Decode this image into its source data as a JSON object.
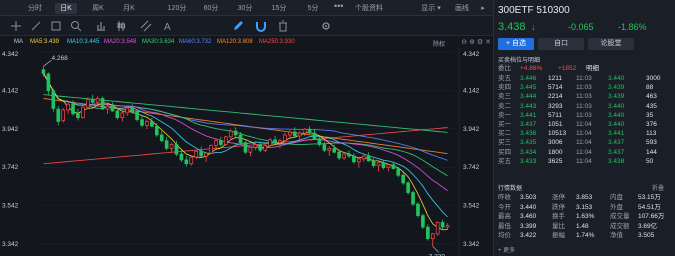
{
  "periods": [
    {
      "label": "分时",
      "active": false
    },
    {
      "label": "日K",
      "active": true
    },
    {
      "label": "周K",
      "active": false
    },
    {
      "label": "月K",
      "active": false
    },
    {
      "label": "120分",
      "active": false
    },
    {
      "label": "60分",
      "active": false
    },
    {
      "label": "30分",
      "active": false
    },
    {
      "label": "15分",
      "active": false
    },
    {
      "label": "5分",
      "active": false
    }
  ],
  "more": "•••",
  "stock_info_tab": "个股资料",
  "display_menu": "显示 ▾",
  "draw_line": "画线",
  "tools": [
    "crosshair-icon",
    "line-tool-icon",
    "rect-tool-icon",
    "zoom-icon",
    "bar-chart-icon",
    "candle-style-icon",
    "parallel-line-icon",
    "text-tool-icon",
    "pencil-icon",
    "magnet-icon",
    "delete-icon",
    "settings-icon"
  ],
  "ma": {
    "label": "MA",
    "ma5": "MA5:3.439",
    "ma10": "MA10:3.445",
    "ma20": "MA20:3.548",
    "ma30": "MA30:3.634",
    "ma60": "MA60:3.732",
    "ma120": "MA120:3.808",
    "ma250": "MA250:3.930",
    "right": "除权",
    "colors": {
      "ma5": "#f5d33a",
      "ma10": "#3fd1f5",
      "ma20": "#e055e0",
      "ma30": "#34d17a",
      "ma60": "#5a86ff",
      "ma120": "#ff8a2a",
      "ma250": "#ff4a4a"
    }
  },
  "chart_data": {
    "type": "candlestick",
    "ylim": [
      3.342,
      4.342
    ],
    "yticks": [
      "4.342",
      "4.142",
      "3.942",
      "3.742",
      "3.542",
      "3.342"
    ],
    "annotations": {
      "high": "4.268",
      "low": "3.330"
    },
    "candles": [
      [
        4.25,
        4.268,
        4.215,
        4.23
      ],
      [
        4.228,
        4.235,
        4.12,
        4.14
      ],
      [
        4.14,
        4.15,
        4.03,
        4.048
      ],
      [
        4.045,
        4.06,
        3.96,
        3.98
      ],
      [
        3.985,
        4.05,
        3.975,
        4.04
      ],
      [
        4.04,
        4.08,
        4.02,
        4.07
      ],
      [
        4.07,
        4.09,
        4.01,
        4.02
      ],
      [
        4.02,
        4.045,
        3.985,
        4.0
      ],
      [
        4.0,
        4.06,
        3.995,
        4.055
      ],
      [
        4.055,
        4.105,
        4.045,
        4.095
      ],
      [
        4.095,
        4.12,
        4.07,
        4.08
      ],
      [
        4.08,
        4.11,
        4.06,
        4.1
      ],
      [
        4.1,
        4.11,
        4.04,
        4.045
      ],
      [
        4.045,
        4.07,
        4.02,
        4.06
      ],
      [
        4.06,
        4.08,
        4.03,
        4.035
      ],
      [
        4.035,
        4.05,
        3.99,
        4.0
      ],
      [
        4.0,
        4.03,
        3.98,
        4.025
      ],
      [
        4.025,
        4.06,
        4.01,
        4.05
      ],
      [
        4.05,
        4.07,
        4.02,
        4.03
      ],
      [
        4.03,
        4.045,
        3.98,
        3.99
      ],
      [
        3.99,
        4.01,
        3.95,
        3.96
      ],
      [
        3.96,
        3.99,
        3.94,
        3.98
      ],
      [
        3.98,
        4.0,
        3.95,
        3.955
      ],
      [
        3.955,
        3.97,
        3.9,
        3.91
      ],
      [
        3.91,
        3.93,
        3.87,
        3.88
      ],
      [
        3.88,
        3.9,
        3.83,
        3.84
      ],
      [
        3.84,
        3.87,
        3.82,
        3.86
      ],
      [
        3.86,
        3.88,
        3.8,
        3.81
      ],
      [
        3.81,
        3.83,
        3.77,
        3.78
      ],
      [
        3.78,
        3.8,
        3.745,
        3.76
      ],
      [
        3.76,
        3.8,
        3.75,
        3.795
      ],
      [
        3.795,
        3.83,
        3.785,
        3.825
      ],
      [
        3.825,
        3.85,
        3.79,
        3.8
      ],
      [
        3.8,
        3.82,
        3.77,
        3.815
      ],
      [
        3.815,
        3.86,
        3.81,
        3.855
      ],
      [
        3.855,
        3.89,
        3.84,
        3.88
      ],
      [
        3.88,
        3.9,
        3.85,
        3.86
      ],
      [
        3.86,
        3.905,
        3.855,
        3.9
      ],
      [
        3.9,
        3.94,
        3.89,
        3.93
      ],
      [
        3.93,
        3.95,
        3.9,
        3.91
      ],
      [
        3.91,
        3.925,
        3.86,
        3.87
      ],
      [
        3.87,
        3.88,
        3.81,
        3.82
      ],
      [
        3.82,
        3.85,
        3.8,
        3.845
      ],
      [
        3.845,
        3.87,
        3.83,
        3.86
      ],
      [
        3.86,
        3.875,
        3.82,
        3.83
      ],
      [
        3.83,
        3.86,
        3.82,
        3.855
      ],
      [
        3.855,
        3.895,
        3.845,
        3.885
      ],
      [
        3.885,
        3.905,
        3.86,
        3.87
      ],
      [
        3.87,
        3.89,
        3.84,
        3.88
      ],
      [
        3.88,
        3.92,
        3.87,
        3.91
      ],
      [
        3.91,
        3.935,
        3.895,
        3.925
      ],
      [
        3.925,
        3.95,
        3.9,
        3.905
      ],
      [
        3.905,
        3.93,
        3.88,
        3.92
      ],
      [
        3.92,
        3.945,
        3.905,
        3.94
      ],
      [
        3.94,
        3.955,
        3.915,
        3.92
      ],
      [
        3.92,
        3.94,
        3.885,
        3.89
      ],
      [
        3.89,
        3.905,
        3.85,
        3.86
      ],
      [
        3.86,
        3.875,
        3.82,
        3.83
      ],
      [
        3.83,
        3.85,
        3.8,
        3.84
      ],
      [
        3.84,
        3.86,
        3.815,
        3.82
      ],
      [
        3.82,
        3.835,
        3.78,
        3.79
      ],
      [
        3.79,
        3.82,
        3.78,
        3.81
      ],
      [
        3.81,
        3.83,
        3.79,
        3.8
      ],
      [
        3.8,
        3.815,
        3.76,
        3.77
      ],
      [
        3.77,
        3.79,
        3.74,
        3.785
      ],
      [
        3.785,
        3.81,
        3.77,
        3.8
      ],
      [
        3.8,
        3.82,
        3.77,
        3.775
      ],
      [
        3.775,
        3.79,
        3.74,
        3.75
      ],
      [
        3.75,
        3.77,
        3.72,
        3.765
      ],
      [
        3.765,
        3.78,
        3.73,
        3.74
      ],
      [
        3.74,
        3.76,
        3.72,
        3.755
      ],
      [
        3.755,
        3.77,
        3.73,
        3.735
      ],
      [
        3.735,
        3.74,
        3.69,
        3.7
      ],
      [
        3.7,
        3.715,
        3.65,
        3.66
      ],
      [
        3.66,
        3.67,
        3.6,
        3.61
      ],
      [
        3.61,
        3.62,
        3.54,
        3.55
      ],
      [
        3.55,
        3.56,
        3.48,
        3.49
      ],
      [
        3.49,
        3.5,
        3.42,
        3.43
      ],
      [
        3.43,
        3.445,
        3.36,
        3.37
      ],
      [
        3.37,
        3.4,
        3.33,
        3.395
      ],
      [
        3.395,
        3.46,
        3.385,
        3.455
      ],
      [
        3.455,
        3.47,
        3.42,
        3.43
      ],
      [
        3.43,
        3.45,
        3.415,
        3.438
      ]
    ]
  },
  "panel": {
    "code_name": "300ETF 510300",
    "price": "3.438",
    "arrow": "↓",
    "change": "-0.065",
    "pct": "-1.86%",
    "buttons": {
      "buy": "+ 自选",
      "sell": "自口",
      "compare": "论股堂"
    },
    "ob_title": "买卖档位与明细",
    "ob_ratio_label": "委比",
    "ob_ratio": "+4.86%",
    "ob_diff": "+1852",
    "ob_detail": "明细",
    "orderbook": [
      {
        "label": "卖五",
        "price": "3.446",
        "vol": "1211",
        "time": "11:03",
        "tp": "3.440",
        "tv": "3000"
      },
      {
        "label": "卖四",
        "price": "3.445",
        "vol": "5714",
        "time": "11:03",
        "tp": "3.439",
        "tv": "88"
      },
      {
        "label": "卖三",
        "price": "3.444",
        "vol": "2214",
        "time": "11:03",
        "tp": "3.439",
        "tv": "463"
      },
      {
        "label": "卖二",
        "price": "3.443",
        "vol": "3293",
        "time": "11:03",
        "tp": "3.440",
        "tv": "435"
      },
      {
        "label": "卖一",
        "price": "3.441",
        "vol": "5711",
        "time": "11:03",
        "tp": "3.440",
        "tv": "35"
      },
      {
        "label": "买一",
        "price": "3.437",
        "vol": "1051",
        "time": "11:04",
        "tp": "3.440",
        "tv": "376"
      },
      {
        "label": "买二",
        "price": "3.436",
        "vol": "10513",
        "time": "11:04",
        "tp": "3.441",
        "tv": "113"
      },
      {
        "label": "买三",
        "price": "3.435",
        "vol": "3006",
        "time": "11:04",
        "tp": "3.437",
        "tv": "593"
      },
      {
        "label": "买四",
        "price": "3.434",
        "vol": "1800",
        "time": "11:04",
        "tp": "3.437",
        "tv": "144"
      },
      {
        "label": "买五",
        "price": "3.433",
        "vol": "3625",
        "time": "11:04",
        "tp": "3.438",
        "tv": "50"
      }
    ],
    "stats_title": "行情数据",
    "stats_fold": "折叠",
    "stats": [
      [
        "昨收",
        "3.503",
        "涨停",
        "3.853",
        "内盘",
        "53.15万"
      ],
      [
        "今开",
        "3.440",
        "跌停",
        "3.153",
        "外盘",
        "54.51万"
      ],
      [
        "最高",
        "3.460",
        "换手",
        "1.63%",
        "成交量",
        "107.66万"
      ],
      [
        "最低",
        "3.399",
        "量比",
        "1.48",
        "成交额",
        "3.69亿"
      ],
      [
        "均价",
        "3.422",
        "振幅",
        "1.74%",
        "净值",
        "3.505"
      ]
    ],
    "more": "+ 更多"
  }
}
